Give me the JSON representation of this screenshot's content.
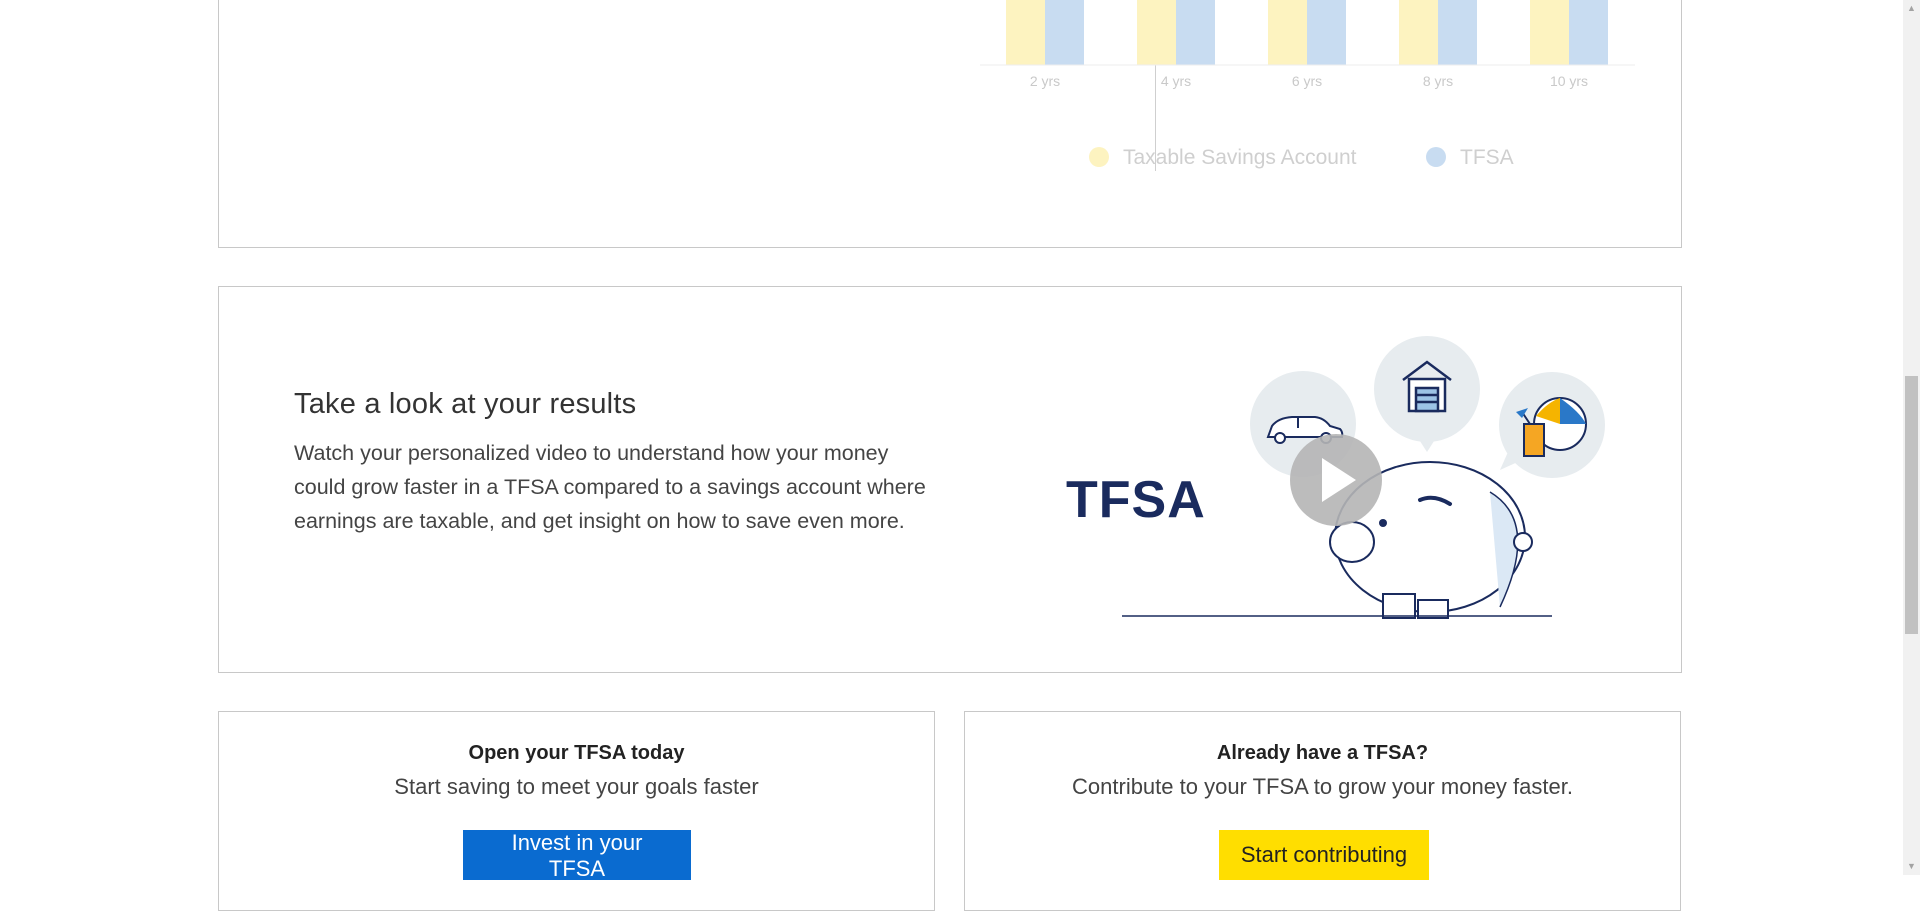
{
  "chart": {
    "xaxis_labels": [
      "2 yrs",
      "4 yrs",
      "6 yrs",
      "8 yrs",
      "10 yrs"
    ],
    "legend": [
      {
        "label": "Taxable Savings Account",
        "color": "#fdf3c0"
      },
      {
        "label": "TFSA",
        "color": "#c8dcf1"
      }
    ]
  },
  "chart_data": {
    "type": "bar",
    "categories": [
      "2 yrs",
      "4 yrs",
      "6 yrs",
      "8 yrs",
      "10 yrs"
    ],
    "series": [
      {
        "name": "Taxable Savings Account",
        "color": "#fdf3c0"
      },
      {
        "name": "TFSA",
        "color": "#c8dcf1"
      }
    ],
    "legend_placement": "bottom-center"
  },
  "video": {
    "heading": "Take a look at your results",
    "description": "Watch your personalized video to understand how your money could grow faster in a TFSA compared to a savings account where earnings are taxable, and get insight on how to save even more.",
    "illustration_text": "TFSA",
    "play_icon": "play-icon"
  },
  "cta_open": {
    "title": "Open your TFSA today",
    "subtitle": "Start saving to meet your goals faster",
    "button": "Invest in your TFSA"
  },
  "cta_existing": {
    "title": "Already have a TFSA?",
    "subtitle": "Contribute to your TFSA to grow your money faster.",
    "button": "Start contributing"
  },
  "colors": {
    "primary_button": "#0a6bd0",
    "secondary_button": "#ffde00",
    "brand_navy": "#1a2b5e"
  }
}
